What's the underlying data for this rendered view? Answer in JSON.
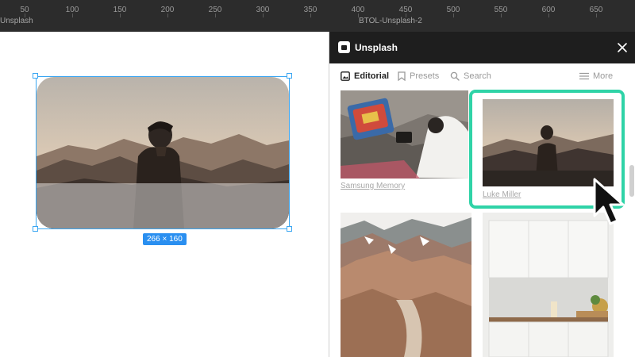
{
  "ruler": {
    "ticks": [
      "50",
      "100",
      "150",
      "200",
      "250",
      "300",
      "350",
      "400",
      "450",
      "500",
      "550",
      "600",
      "650"
    ],
    "frame_left": "Unsplash",
    "frame_right": "BTOL-Unsplash-2"
  },
  "canvas": {
    "dimensions_label": "266 × 160"
  },
  "panel": {
    "title": "Unsplash",
    "tabs": [
      {
        "label": "Editorial",
        "icon": "image-icon",
        "active": true
      },
      {
        "label": "Presets",
        "icon": "bookmark-icon",
        "active": false
      },
      {
        "label": "Search",
        "icon": "search-icon",
        "active": false
      }
    ],
    "more_label": "More",
    "photos": [
      {
        "credit": "Samsung Memory"
      },
      {
        "credit": "Luke Miller"
      },
      {
        "credit": ""
      },
      {
        "credit": ""
      }
    ]
  },
  "colors": {
    "accent": "#2fd3a7",
    "selection": "#3aa6f2",
    "header_bg": "#1e1e1e"
  }
}
